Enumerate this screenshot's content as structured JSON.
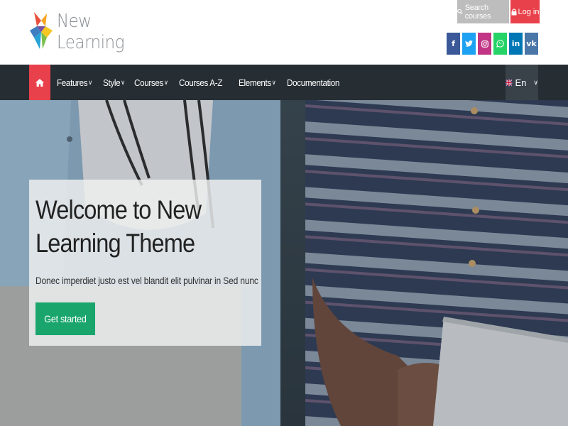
{
  "brand": {
    "name_line1": "New",
    "name_line2": "Learning"
  },
  "header": {
    "search_label": "Search courses",
    "login_label": "Log in",
    "search_icon": "magnifier-icon",
    "login_icon": "lock-icon"
  },
  "socials": [
    {
      "name": "facebook",
      "glyph": "f",
      "color": "#3b5998"
    },
    {
      "name": "twitter",
      "glyph": "t",
      "color": "#1da1f2"
    },
    {
      "name": "instagram",
      "glyph": "◎",
      "color": "#c13584"
    },
    {
      "name": "whatsapp",
      "glyph": "✆",
      "color": "#25d366"
    },
    {
      "name": "linkedin",
      "glyph": "in",
      "color": "#0077b5"
    },
    {
      "name": "vk",
      "glyph": "vk",
      "color": "#4a76a8"
    }
  ],
  "nav": {
    "home_icon": "home-icon",
    "items": [
      {
        "label": "Features",
        "dropdown": true
      },
      {
        "label": "Style",
        "dropdown": true
      },
      {
        "label": "Courses",
        "dropdown": true
      },
      {
        "label": "Courses A-Z",
        "dropdown": false
      },
      {
        "label": "Elements",
        "dropdown": true
      },
      {
        "label": "Documentation",
        "dropdown": false
      }
    ],
    "language": "En"
  },
  "hero": {
    "title": "Welcome to New Learning Theme",
    "subtitle": "Donec imperdiet justo est vel blandit elit pulvinar in Sed nunc",
    "cta_label": "Get started"
  },
  "colors": {
    "accent_red": "#e9414b",
    "navbar_bg": "#262d33",
    "cta_green": "#19a56c"
  }
}
